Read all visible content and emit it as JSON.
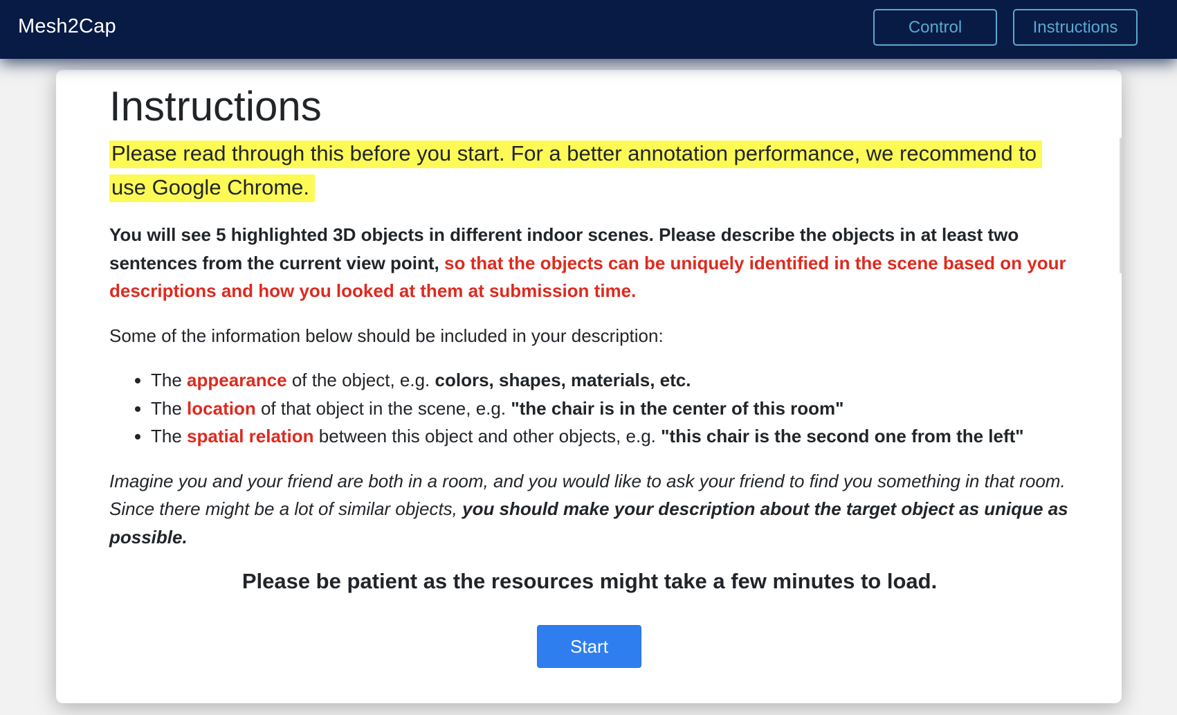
{
  "header": {
    "brand": "Mesh2Cap",
    "nav": {
      "control_label": "Control",
      "instructions_label": "Instructions"
    }
  },
  "instructions": {
    "title": "Instructions",
    "highlight": "Please read through this before you start. For a better annotation performance, we recommend to use Google Chrome.",
    "intro_bold": "You will see 5 highlighted 3D objects in different indoor scenes. Please describe the objects in at least two sentences from the current view point,",
    "intro_red": "so that the objects can be uniquely identified in the scene based on your descriptions and how you looked at them at submission time.",
    "list_lead": "Some of the information below should be included in your description:",
    "items": [
      {
        "prefix": "The",
        "keyword": "appearance",
        "middle": "of the object, e.g.",
        "example": "colors, shapes, materials, etc."
      },
      {
        "prefix": "The",
        "keyword": "location",
        "middle": "of that object in the scene, e.g.",
        "example": "\"the chair is in the center of this room\""
      },
      {
        "prefix": "The",
        "keyword": "spatial relation",
        "middle": "between this object and other objects, e.g.",
        "example": "\"this chair is the second one from the left\""
      }
    ],
    "imagine_text": "Imagine you and your friend are both in a room, and you would like to ask your friend to find you something in that room. Since there might be a lot of similar objects,",
    "imagine_bold": "you should make your description about the target object as unique as possible.",
    "patience": "Please be patient as the resources might take a few minutes to load.",
    "start_label": "Start"
  },
  "colors": {
    "header_bg": "#081b45",
    "nav_outline": "#5aa9cf",
    "highlight": "#fdfa55",
    "emphasis_red": "#de2a1f",
    "start_button": "#2f7ef0"
  }
}
